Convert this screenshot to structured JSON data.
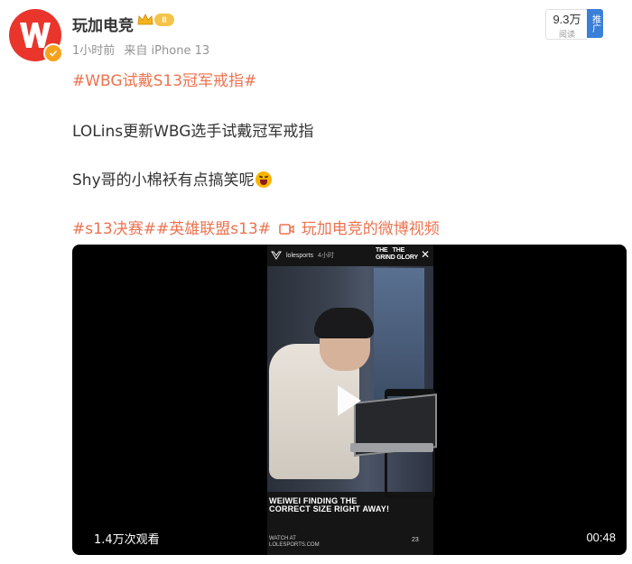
{
  "author": {
    "name": "玩加电竞",
    "level": "II",
    "time": "1小时前",
    "source": "来自 iPhone 13"
  },
  "stats": {
    "reads": "9.3万",
    "reads_label": "阅读",
    "promote_label": "推广"
  },
  "post": {
    "topic": "#WBG试戴S13冠军戒指#",
    "line1": "LOLins更新WBG选手试戴冠军戒指",
    "line2": "Shy哥的小棉袄有点搞笑呢",
    "tags": "#s13决赛##英雄联盟s13#",
    "video_link": "玩加电竞的微博视频"
  },
  "video": {
    "views": "1.4万次观看",
    "duration": "00:48",
    "frame": {
      "handle": "lolesports",
      "time": "4小时",
      "brand_line1": "THE",
      "brand_line2": "GRIND",
      "brand_line3": "THE",
      "brand_line4": "GLORY",
      "caption_line1": "WEIWEI FINDING THE",
      "caption_line2": "CORRECT SIZE RIGHT AWAY!",
      "watch_line1": "WATCH AT",
      "watch_line2": "LOLESPORTS.COM",
      "badge": "23"
    }
  },
  "colors": {
    "hashtag": "#eb7350",
    "avatar": "#e9352c",
    "promote": "#3a7fd8"
  }
}
